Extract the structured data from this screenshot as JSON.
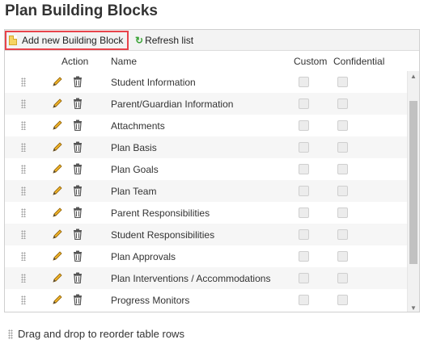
{
  "page": {
    "title": "Plan Building Blocks"
  },
  "toolbar": {
    "add_label": "Add new Building Block",
    "refresh_label": "Refresh list",
    "add_icon": "document-icon",
    "refresh_icon": "refresh-icon"
  },
  "table": {
    "headers": {
      "action": "Action",
      "name": "Name",
      "custom": "Custom",
      "confidential": "Confidential"
    },
    "rows": [
      {
        "name": "Student Information",
        "custom": false,
        "confidential": false
      },
      {
        "name": "Parent/Guardian Information",
        "custom": false,
        "confidential": false
      },
      {
        "name": "Attachments",
        "custom": false,
        "confidential": false
      },
      {
        "name": "Plan Basis",
        "custom": false,
        "confidential": false
      },
      {
        "name": "Plan Goals",
        "custom": false,
        "confidential": false
      },
      {
        "name": "Plan Team",
        "custom": false,
        "confidential": false
      },
      {
        "name": "Parent Responsibilities",
        "custom": false,
        "confidential": false
      },
      {
        "name": "Student Responsibilities",
        "custom": false,
        "confidential": false
      },
      {
        "name": "Plan Approvals",
        "custom": false,
        "confidential": false
      },
      {
        "name": "Plan Interventions / Accommodations",
        "custom": false,
        "confidential": false
      },
      {
        "name": "Progress Monitors",
        "custom": false,
        "confidential": false
      }
    ]
  },
  "footer": {
    "hint": "Drag and drop to reorder table rows"
  },
  "colors": {
    "highlight_border": "#e8434b",
    "refresh_green": "#3aa336",
    "pencil_yellow": "#f0b429"
  }
}
